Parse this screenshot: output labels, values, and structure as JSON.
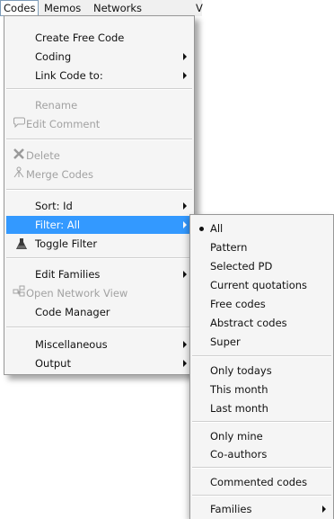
{
  "menubar": {
    "items": [
      {
        "label": "Codes"
      },
      {
        "label": "Memos"
      },
      {
        "label": "Networks"
      },
      {
        "label": "V"
      }
    ]
  },
  "codes_menu": {
    "create_free_code": "Create Free Code",
    "coding": "Coding",
    "link_code_to": "Link Code to:",
    "rename": "Rename",
    "edit_comment": "Edit Comment",
    "delete": "Delete",
    "merge_codes": "Merge Codes",
    "sort": "Sort: Id",
    "filter": "Filter: All",
    "toggle_filter": "Toggle Filter",
    "edit_families": "Edit Families",
    "open_network_view": "Open Network View",
    "code_manager": "Code Manager",
    "miscellaneous": "Miscellaneous",
    "output": "Output"
  },
  "filter_submenu": {
    "all": "All",
    "pattern": "Pattern",
    "selected_pd": "Selected PD",
    "current_quotations": "Current quotations",
    "free_codes": "Free codes",
    "abstract_codes": "Abstract codes",
    "super": "Super",
    "only_todays": "Only todays",
    "this_month": "This month",
    "last_month": "Last month",
    "only_mine": "Only mine",
    "co_authors": "Co-authors",
    "commented_codes": "Commented codes",
    "families": "Families"
  },
  "colors": {
    "highlight": "#3399ff",
    "disabled_text": "#a2a2a2"
  }
}
